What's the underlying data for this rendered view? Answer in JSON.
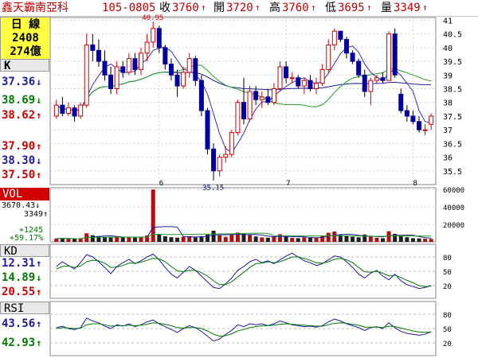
{
  "header": {
    "name": "鑫天霸南亞科",
    "date": "105-0805",
    "close_label": "收",
    "close_value": "3760",
    "open_label": "開",
    "open_value": "3720",
    "high_label": "高",
    "high_value": "3760",
    "low_label": "低",
    "low_value": "3695",
    "vol_label": "量",
    "vol_value": "3349",
    "up_arrow": "↑"
  },
  "info_box": {
    "line1": "日 線",
    "line2": "2408",
    "line3": "274億"
  },
  "k_panel": {
    "tag": "K",
    "ma_values": [
      {
        "value": "37.36",
        "arrow": "↓",
        "color": "#1a1aa6"
      },
      {
        "value": "38.69",
        "arrow": "↓",
        "color": "#007a00"
      },
      {
        "value": "38.62",
        "arrow": "↑",
        "color": "#d00000"
      }
    ],
    "level_values": [
      {
        "value": "37.90",
        "arrow": "↑",
        "color": "#d00000"
      },
      {
        "value": "38.30",
        "arrow": "↓",
        "color": "#1a1aa6"
      },
      {
        "value": "37.50",
        "arrow": "↑",
        "color": "#d00000"
      }
    ]
  },
  "vol_panel": {
    "tag": "VOL",
    "line1": "3670.43↓",
    "line2": "3349↑",
    "line3": "+1245",
    "line4": "+59.17%"
  },
  "kd_panel": {
    "tag": "KD",
    "values": [
      {
        "value": "12.31",
        "arrow": "↑",
        "color": "#1a1aa6"
      },
      {
        "value": "14.89",
        "arrow": "↓",
        "color": "#007a00"
      },
      {
        "value": "20.55",
        "arrow": "↑",
        "color": "#d00000"
      }
    ]
  },
  "rsi_panel": {
    "tag": "RSI",
    "values": [
      {
        "value": "43.56",
        "arrow": "↑",
        "color": "#1a1aa6"
      },
      {
        "value": "42.93",
        "arrow": "↑",
        "color": "#007a00"
      }
    ]
  },
  "chart_data": [
    {
      "type": "candlestick",
      "y_ticks": [
        35.5,
        36,
        36.5,
        37,
        37.5,
        38,
        38.5,
        39,
        39.5,
        40,
        40.5,
        41
      ],
      "ylim": [
        35,
        41.1
      ],
      "x_month_labels": [
        {
          "index": 17,
          "label": "6"
        },
        {
          "index": 38,
          "label": "7"
        },
        {
          "index": 59,
          "label": "8"
        }
      ],
      "annotations": [
        {
          "index": 16,
          "value": 40.95,
          "label": "40.95"
        },
        {
          "index": 26,
          "value": 35.15,
          "label": "35.15"
        }
      ],
      "candles": [
        {
          "o": 37.5,
          "h": 38.1,
          "l": 37.4,
          "c": 37.9
        },
        {
          "o": 37.9,
          "h": 38.2,
          "l": 37.5,
          "c": 37.6
        },
        {
          "o": 37.6,
          "h": 38.0,
          "l": 37.5,
          "c": 37.8
        },
        {
          "o": 37.8,
          "h": 37.9,
          "l": 37.3,
          "c": 37.5
        },
        {
          "o": 37.5,
          "h": 38.0,
          "l": 37.4,
          "c": 37.9
        },
        {
          "o": 37.9,
          "h": 40.5,
          "l": 37.8,
          "c": 40.1
        },
        {
          "o": 40.1,
          "h": 40.5,
          "l": 39.5,
          "c": 39.9
        },
        {
          "o": 39.9,
          "h": 40.3,
          "l": 39.3,
          "c": 39.5
        },
        {
          "o": 39.5,
          "h": 39.9,
          "l": 38.8,
          "c": 39.0
        },
        {
          "o": 39.0,
          "h": 39.3,
          "l": 38.3,
          "c": 38.5
        },
        {
          "o": 38.5,
          "h": 39.5,
          "l": 38.3,
          "c": 39.3
        },
        {
          "o": 39.3,
          "h": 39.5,
          "l": 38.9,
          "c": 39.1
        },
        {
          "o": 39.1,
          "h": 39.8,
          "l": 39.0,
          "c": 39.6
        },
        {
          "o": 39.6,
          "h": 39.8,
          "l": 39.0,
          "c": 39.2
        },
        {
          "o": 39.2,
          "h": 40.0,
          "l": 39.0,
          "c": 39.8
        },
        {
          "o": 39.8,
          "h": 40.5,
          "l": 39.5,
          "c": 40.2
        },
        {
          "o": 40.2,
          "h": 40.95,
          "l": 40.0,
          "c": 40.7
        },
        {
          "o": 40.7,
          "h": 40.8,
          "l": 39.8,
          "c": 40.0
        },
        {
          "o": 40.0,
          "h": 40.1,
          "l": 39.2,
          "c": 39.4
        },
        {
          "o": 39.4,
          "h": 39.6,
          "l": 38.8,
          "c": 39.0
        },
        {
          "o": 39.0,
          "h": 39.2,
          "l": 38.2,
          "c": 38.6
        },
        {
          "o": 38.6,
          "h": 39.3,
          "l": 38.5,
          "c": 39.1
        },
        {
          "o": 39.1,
          "h": 39.8,
          "l": 38.9,
          "c": 39.6
        },
        {
          "o": 39.6,
          "h": 39.7,
          "l": 38.6,
          "c": 38.8
        },
        {
          "o": 38.8,
          "h": 39.0,
          "l": 37.5,
          "c": 37.7
        },
        {
          "o": 37.7,
          "h": 37.8,
          "l": 36.1,
          "c": 36.3
        },
        {
          "o": 36.3,
          "h": 36.5,
          "l": 35.15,
          "c": 35.5
        },
        {
          "o": 35.5,
          "h": 36.1,
          "l": 35.3,
          "c": 36.0
        },
        {
          "o": 36.0,
          "h": 36.4,
          "l": 35.8,
          "c": 36.1
        },
        {
          "o": 36.1,
          "h": 37.0,
          "l": 36.0,
          "c": 36.9
        },
        {
          "o": 36.9,
          "h": 38.1,
          "l": 36.8,
          "c": 38.0
        },
        {
          "o": 38.0,
          "h": 38.9,
          "l": 37.2,
          "c": 37.4
        },
        {
          "o": 37.4,
          "h": 38.6,
          "l": 37.3,
          "c": 38.4
        },
        {
          "o": 38.4,
          "h": 38.6,
          "l": 37.9,
          "c": 38.1
        },
        {
          "o": 38.1,
          "h": 38.4,
          "l": 37.8,
          "c": 38.2
        },
        {
          "o": 38.2,
          "h": 38.5,
          "l": 37.9,
          "c": 38.0
        },
        {
          "o": 38.0,
          "h": 38.7,
          "l": 37.9,
          "c": 38.5
        },
        {
          "o": 38.5,
          "h": 39.5,
          "l": 38.4,
          "c": 39.3
        },
        {
          "o": 39.3,
          "h": 39.5,
          "l": 38.7,
          "c": 38.9
        },
        {
          "o": 38.9,
          "h": 39.1,
          "l": 38.7,
          "c": 38.9
        },
        {
          "o": 38.9,
          "h": 39.0,
          "l": 38.5,
          "c": 38.6
        },
        {
          "o": 38.6,
          "h": 38.9,
          "l": 38.3,
          "c": 38.8
        },
        {
          "o": 38.8,
          "h": 39.0,
          "l": 38.4,
          "c": 38.5
        },
        {
          "o": 38.5,
          "h": 38.9,
          "l": 38.3,
          "c": 38.7
        },
        {
          "o": 38.7,
          "h": 39.4,
          "l": 38.6,
          "c": 39.2
        },
        {
          "o": 39.2,
          "h": 40.3,
          "l": 39.1,
          "c": 40.1
        },
        {
          "o": 40.1,
          "h": 40.7,
          "l": 39.9,
          "c": 40.6
        },
        {
          "o": 40.6,
          "h": 40.6,
          "l": 40.2,
          "c": 40.3
        },
        {
          "o": 40.3,
          "h": 40.4,
          "l": 39.6,
          "c": 39.8
        },
        {
          "o": 39.8,
          "h": 39.9,
          "l": 39.4,
          "c": 39.5
        },
        {
          "o": 39.5,
          "h": 39.6,
          "l": 38.9,
          "c": 39.0
        },
        {
          "o": 39.0,
          "h": 39.2,
          "l": 38.2,
          "c": 38.4
        },
        {
          "o": 38.4,
          "h": 38.9,
          "l": 37.9,
          "c": 38.8
        },
        {
          "o": 38.8,
          "h": 39.0,
          "l": 38.7,
          "c": 38.9
        },
        {
          "o": 38.9,
          "h": 39.1,
          "l": 38.7,
          "c": 38.8
        },
        {
          "o": 38.8,
          "h": 40.6,
          "l": 38.8,
          "c": 40.5
        },
        {
          "o": 40.5,
          "h": 40.7,
          "l": 38.9,
          "c": 39.0
        },
        {
          "o": 38.3,
          "h": 38.5,
          "l": 37.6,
          "c": 37.7
        },
        {
          "o": 37.7,
          "h": 37.9,
          "l": 37.3,
          "c": 37.5
        },
        {
          "o": 37.5,
          "h": 37.7,
          "l": 37.2,
          "c": 37.3
        },
        {
          "o": 37.3,
          "h": 37.5,
          "l": 36.9,
          "c": 37.0
        },
        {
          "o": 37.0,
          "h": 37.2,
          "l": 36.8,
          "c": 37.0
        },
        {
          "o": 37.2,
          "h": 37.6,
          "l": 37.0,
          "c": 37.5
        }
      ]
    },
    {
      "type": "bar",
      "title": "VOL",
      "y_ticks": [
        20000,
        40000,
        60000
      ],
      "ylim": [
        0,
        62000
      ],
      "values": [
        3800,
        4200,
        3500,
        3200,
        4100,
        9800,
        7600,
        6500,
        5400,
        5200,
        6100,
        5000,
        5600,
        4900,
        5300,
        7300,
        9600,
        8200,
        6400,
        5300,
        4800,
        5900,
        6500,
        5200,
        6400,
        8400,
        12800,
        7400,
        5700,
        8100,
        10600,
        9300,
        7800,
        6200,
        5100,
        4700,
        6000,
        8700,
        6300,
        4500,
        4200,
        5200,
        4600,
        4900,
        6700,
        10400,
        11800,
        7900,
        6800,
        5900,
        5200,
        8400,
        6100,
        4700,
        4100,
        12200,
        9100,
        7600,
        5300,
        4200,
        3900,
        3600,
        3349
      ],
      "spike": {
        "index": 16,
        "value": 60000
      }
    },
    {
      "type": "line",
      "title": "KD",
      "y_ticks": [
        20,
        50,
        80
      ],
      "ylim": [
        0,
        100
      ],
      "series": [
        {
          "color": "#1a1aa6",
          "values": [
            60,
            70,
            62,
            55,
            68,
            85,
            80,
            70,
            58,
            45,
            60,
            68,
            75,
            66,
            72,
            80,
            86,
            74,
            58,
            44,
            36,
            48,
            60,
            52,
            40,
            28,
            16,
            14,
            24,
            36,
            52,
            60,
            70,
            75,
            68,
            72,
            66,
            74,
            82,
            88,
            80,
            72,
            68,
            62,
            66,
            74,
            82,
            80,
            70,
            58,
            44,
            36,
            46,
            52,
            40,
            32,
            44,
            30,
            22,
            18,
            14,
            16,
            20
          ]
        },
        {
          "color": "#007a00",
          "values": [
            55,
            60,
            61,
            58,
            61,
            70,
            73,
            72,
            67,
            58,
            59,
            62,
            67,
            67,
            69,
            73,
            77,
            76,
            70,
            60,
            51,
            49,
            52,
            52,
            47,
            40,
            30,
            22,
            22,
            28,
            38,
            48,
            58,
            66,
            67,
            70,
            68,
            70,
            75,
            80,
            80,
            77,
            73,
            68,
            67,
            70,
            75,
            77,
            74,
            68,
            58,
            49,
            48,
            50,
            46,
            40,
            42,
            37,
            31,
            26,
            20,
            18,
            19
          ]
        }
      ]
    },
    {
      "type": "line",
      "title": "RSI",
      "y_ticks": [
        20,
        50,
        80
      ],
      "ylim": [
        0,
        100
      ],
      "series": [
        {
          "color": "#1a1aa6",
          "values": [
            52,
            55,
            50,
            48,
            52,
            72,
            66,
            62,
            55,
            50,
            58,
            55,
            60,
            54,
            58,
            64,
            68,
            60,
            54,
            48,
            42,
            50,
            56,
            52,
            44,
            34,
            24,
            28,
            38,
            46,
            58,
            54,
            60,
            58,
            60,
            56,
            60,
            66,
            62,
            58,
            56,
            54,
            55,
            53,
            56,
            64,
            70,
            66,
            60,
            56,
            52,
            46,
            52,
            54,
            50,
            62,
            52,
            44,
            40,
            38,
            36,
            38,
            43.56
          ]
        },
        {
          "color": "#007a00",
          "values": [
            50,
            52,
            51,
            50,
            51,
            58,
            60,
            60,
            58,
            55,
            56,
            56,
            57,
            56,
            57,
            59,
            62,
            61,
            59,
            56,
            52,
            51,
            52,
            52,
            50,
            45,
            38,
            34,
            35,
            39,
            45,
            48,
            52,
            54,
            56,
            56,
            57,
            59,
            60,
            59,
            58,
            57,
            56,
            55,
            55,
            58,
            61,
            62,
            61,
            59,
            57,
            53,
            53,
            53,
            52,
            55,
            54,
            51,
            48,
            45,
            43,
            42,
            42.93
          ]
        }
      ]
    }
  ]
}
